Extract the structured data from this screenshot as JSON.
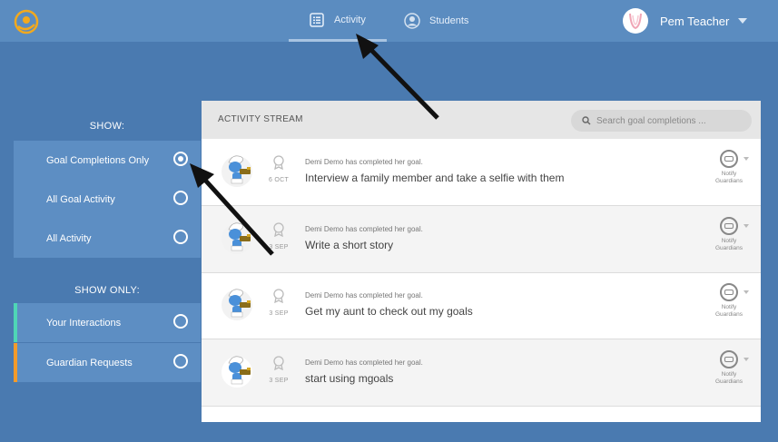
{
  "nav": {
    "tabs": [
      {
        "label": "Activity",
        "icon": "list-icon"
      },
      {
        "label": "Students",
        "icon": "user-icon"
      }
    ],
    "user_name": "Pem Teacher"
  },
  "sidebar": {
    "show_heading": "SHOW:",
    "show_items": [
      {
        "label": "Goal Completions Only",
        "selected": true
      },
      {
        "label": "All Goal Activity",
        "selected": false
      },
      {
        "label": "All Activity",
        "selected": false
      }
    ],
    "show_only_heading": "SHOW ONLY:",
    "show_only_items": [
      {
        "label": "Your Interactions",
        "accent": "#4fd6b6"
      },
      {
        "label": "Guardian Requests",
        "accent": "#f39b2b"
      }
    ]
  },
  "stream": {
    "title": "ACTIVITY STREAM",
    "search_placeholder": "Search goal completions ...",
    "items": [
      {
        "summary": "Demi Demo has completed her goal.",
        "goal": "Interview a family member and take a selfie with them",
        "date": "6 OCT",
        "notify_line1": "Notify",
        "notify_line2": "Guardians"
      },
      {
        "summary": "Demi Demo has completed her goal.",
        "goal": "Write a short story",
        "date": "3 SEP",
        "notify_line1": "Notify",
        "notify_line2": "Guardians"
      },
      {
        "summary": "Demi Demo has completed her goal.",
        "goal": "Get my aunt to check out my goals",
        "date": "3 SEP",
        "notify_line1": "Notify",
        "notify_line2": "Guardians"
      },
      {
        "summary": "Demi Demo has completed her goal.",
        "goal": "start using mgoals",
        "date": "3 SEP",
        "notify_line1": "Notify",
        "notify_line2": "Guardians"
      }
    ]
  },
  "colors": {
    "background": "#4a7ab0",
    "topbar": "#5b8cc0",
    "logo": "#f2a91e"
  }
}
